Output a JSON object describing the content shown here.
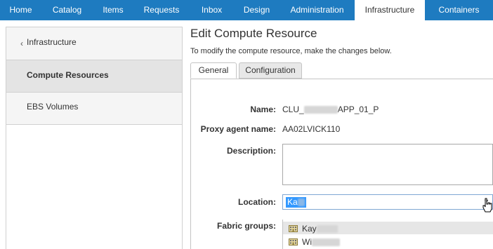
{
  "topnav": {
    "tabs": [
      {
        "label": "Home",
        "active": false
      },
      {
        "label": "Catalog",
        "active": false
      },
      {
        "label": "Items",
        "active": false
      },
      {
        "label": "Requests",
        "active": false
      },
      {
        "label": "Inbox",
        "active": false
      },
      {
        "label": "Design",
        "active": false
      },
      {
        "label": "Administration",
        "active": false
      },
      {
        "label": "Infrastructure",
        "active": true
      },
      {
        "label": "Containers",
        "active": false
      }
    ]
  },
  "sidebar": {
    "back_label": "Infrastructure",
    "items": [
      {
        "label": "Compute Resources",
        "selected": true
      },
      {
        "label": "EBS Volumes",
        "selected": false
      }
    ]
  },
  "main": {
    "title": "Edit Compute Resource",
    "subtitle": "To modify the compute resource, make the changes below.",
    "tabs": [
      {
        "label": "General",
        "active": true
      },
      {
        "label": "Configuration",
        "active": false
      }
    ]
  },
  "form": {
    "name_label": "Name:",
    "name_value_prefix": "CLU_",
    "name_value_suffix": "APP_01_P",
    "proxy_label": "Proxy agent name:",
    "proxy_value": "AA02LVICK110",
    "description_label": "Description:",
    "description_value": "",
    "location_label": "Location:",
    "location_value": "Ka",
    "fabric_groups_label": "Fabric groups:"
  },
  "location_dropdown": {
    "options": [
      {
        "label": "Kay",
        "highlighted": true,
        "icon": "building-icon"
      },
      {
        "label": "Wi",
        "highlighted": false,
        "icon": "building-icon"
      }
    ]
  },
  "colors": {
    "nav_bg": "#1e7bc0",
    "selection": "#3399ff"
  }
}
